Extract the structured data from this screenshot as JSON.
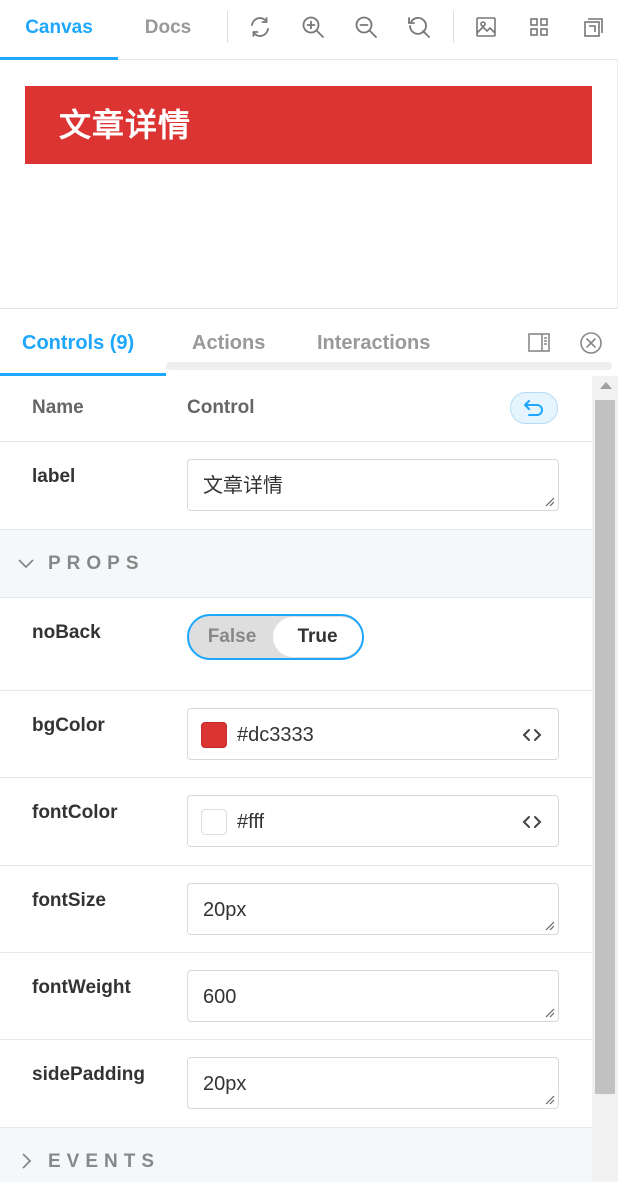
{
  "toolbar": {
    "tabs": [
      {
        "label": "Canvas"
      },
      {
        "label": "Docs"
      }
    ],
    "tools": [
      "refresh-icon",
      "zoom-in-icon",
      "zoom-out-icon",
      "reset-zoom-icon",
      "image-icon",
      "grid-icon",
      "outline-icon"
    ]
  },
  "canvas": {
    "header_text": "文章详情",
    "header_bg": "#dc3333",
    "header_color": "#fff"
  },
  "panel": {
    "tabs": [
      {
        "label": "Controls (9)"
      },
      {
        "label": "Actions"
      },
      {
        "label": "Interactions"
      }
    ],
    "table_headers": {
      "name": "Name",
      "control": "Control"
    },
    "rows": {
      "label": {
        "name": "label",
        "value": "文章详情"
      },
      "props_section": "PROPS",
      "noBack": {
        "name": "noBack",
        "options": [
          "False",
          "True"
        ],
        "selected": "True"
      },
      "bgColor": {
        "name": "bgColor",
        "value": "#dc3333"
      },
      "fontColor": {
        "name": "fontColor",
        "value": "#fff"
      },
      "fontSize": {
        "name": "fontSize",
        "value": "20px"
      },
      "fontWeight": {
        "name": "fontWeight",
        "value": "600"
      },
      "sidePadding": {
        "name": "sidePadding",
        "value": "20px"
      },
      "events_section": "EVENTS"
    }
  },
  "colors": {
    "accent": "#1ea7fd"
  }
}
